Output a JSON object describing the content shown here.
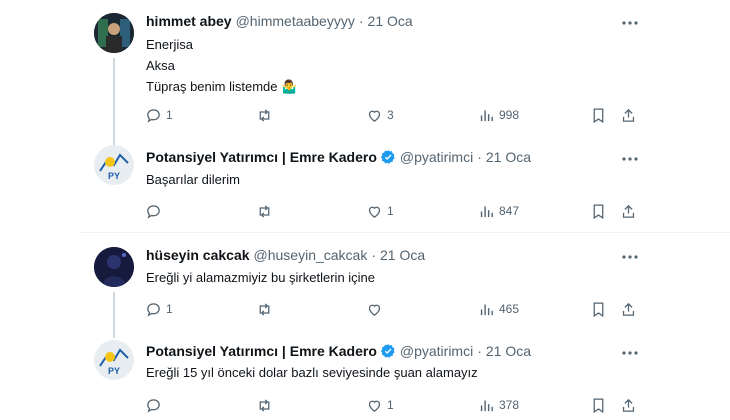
{
  "tweets": [
    {
      "name": "himmet abey",
      "handle": "@himmetaabeyyyy",
      "dot": "·",
      "time": "21 Oca",
      "text_lines": [
        "Enerjisa",
        "Aksa",
        "Tüpraş benim listemde 🤷‍♂️"
      ],
      "replies": "1",
      "retweets": "",
      "likes": "3",
      "views": "998",
      "verified": false
    },
    {
      "name": "Potansiyel Yatırımcı | Emre Kadero",
      "handle": "@pyatirimci",
      "dot": "·",
      "time": "21 Oca",
      "text_lines": [
        "Başarılar dilerim"
      ],
      "replies": "",
      "retweets": "",
      "likes": "1",
      "views": "847",
      "verified": true
    },
    {
      "name": "hüseyin cakcak",
      "handle": "@huseyin_cakcak",
      "dot": "·",
      "time": "21 Oca",
      "text_lines": [
        "Ereğli yi alamazmiyiz bu şirketlerin içine"
      ],
      "replies": "1",
      "retweets": "",
      "likes": "",
      "views": "465",
      "verified": false
    },
    {
      "name": "Potansiyel Yatırımcı | Emre Kadero",
      "handle": "@pyatirimci",
      "dot": "·",
      "time": "21 Oca",
      "text_lines": [
        "Ereğli 15 yıl önceki dolar bazlı seviyesinde şuan alamayız"
      ],
      "replies": "",
      "retweets": "",
      "likes": "1",
      "views": "378",
      "verified": true
    }
  ],
  "colors": {
    "verified": "#1d9bf0",
    "secondary_text": "#536471",
    "divider": "#eff3f4"
  },
  "icons": [
    "more-icon",
    "reply-icon",
    "retweet-icon",
    "like-icon",
    "views-icon",
    "bookmark-icon",
    "share-icon",
    "verified-badge-icon"
  ]
}
